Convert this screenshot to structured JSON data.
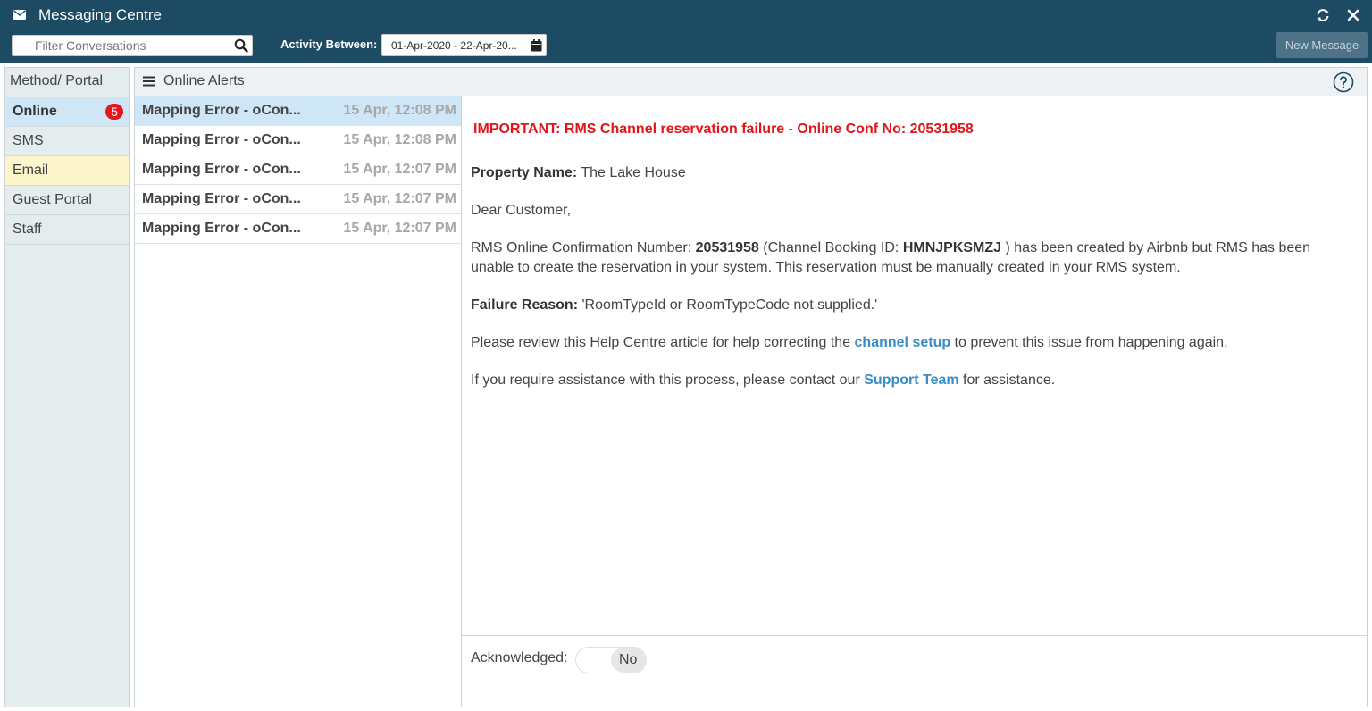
{
  "window": {
    "title": "Messaging Centre"
  },
  "toolbar": {
    "filter_placeholder": "Filter Conversations",
    "activity_label": "Activity Between:",
    "date_range": "01-Apr-2020 - 22-Apr-20...",
    "new_message_label": "New Message"
  },
  "sidebar": {
    "header": "Method/ Portal",
    "items": [
      {
        "label": "Online",
        "badge": "5",
        "state": "selected"
      },
      {
        "label": "SMS"
      },
      {
        "label": "Email",
        "state": "highlighted"
      },
      {
        "label": "Guest Portal"
      },
      {
        "label": "Staff"
      }
    ]
  },
  "main": {
    "title": "Online Alerts",
    "conversations": [
      {
        "subject": "Mapping Error - oCon...",
        "time": "15 Apr, 12:08 PM",
        "state": "selected"
      },
      {
        "subject": "Mapping Error - oCon...",
        "time": "15 Apr, 12:08 PM"
      },
      {
        "subject": "Mapping Error - oCon...",
        "time": "15 Apr, 12:07 PM"
      },
      {
        "subject": "Mapping Error - oCon...",
        "time": "15 Apr, 12:07 PM"
      },
      {
        "subject": "Mapping Error - oCon...",
        "time": "15 Apr, 12:07 PM"
      }
    ]
  },
  "message": {
    "heading": "IMPORTANT: RMS Channel reservation failure - Online Conf No: 20531958",
    "property_label": "Property Name:",
    "property_value": "The Lake House",
    "greeting": "Dear Customer,",
    "p1_text1": "RMS Online Confirmation Number: ",
    "p1_conf_no": "20531958",
    "p1_text2": " (Channel Booking ID: ",
    "p1_booking_id": "HMNJPKSMZJ",
    "p1_text3": " ) has been created by Airbnb but RMS has been unable to create the reservation in your system. This reservation must be manually created in your RMS system.",
    "failure_label": "Failure Reason:",
    "failure_value": "'RoomTypeId or RoomTypeCode not supplied.'",
    "p2_text1": "Please review this Help Centre article for help correcting the ",
    "p2_link": "channel setup",
    "p2_text2": " to prevent this issue from happening again.",
    "p3_text1": "If you require assistance with this process, please contact our ",
    "p3_link": "Support Team",
    "p3_text2": " for assistance."
  },
  "footer": {
    "acknowledged_label": "Acknowledged:",
    "acknowledged_value": "No"
  },
  "colors": {
    "header_bg": "#1d4b63",
    "selected_bg": "#cfe6f7",
    "highlight_bg": "#fdf6cc",
    "badge": "#e5171c",
    "alert_red": "#e3141a",
    "link_blue": "#3a8cc7"
  },
  "icons": [
    "envelope-icon",
    "refresh-icon",
    "close-icon",
    "search-icon",
    "calendar-icon",
    "menu-icon",
    "help-icon"
  ]
}
